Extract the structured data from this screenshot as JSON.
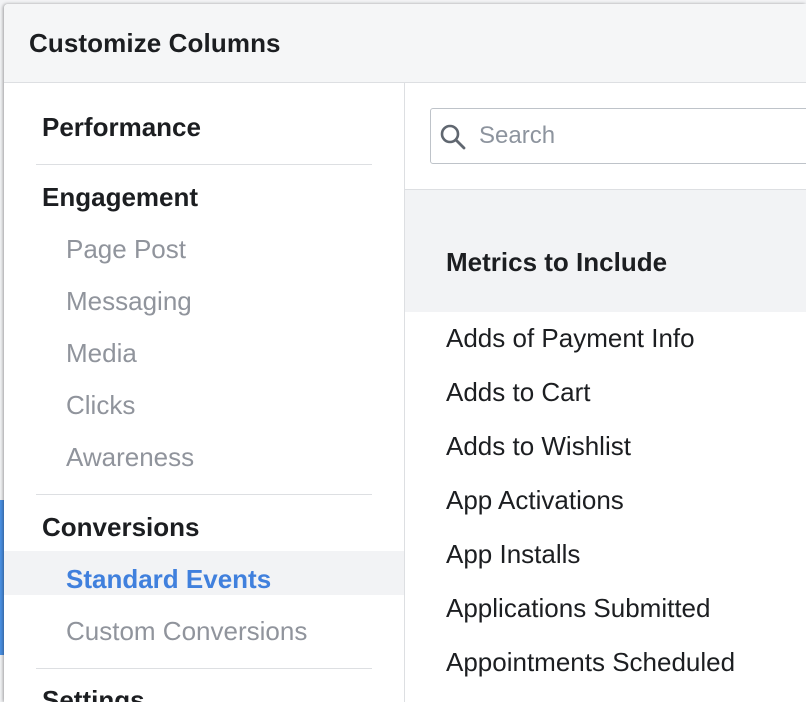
{
  "dialog": {
    "title": "Customize Columns"
  },
  "left_nav": {
    "performance": "Performance",
    "engagement": {
      "label": "Engagement",
      "items": [
        "Page Post",
        "Messaging",
        "Media",
        "Clicks",
        "Awareness"
      ]
    },
    "conversions": {
      "label": "Conversions",
      "items": [
        "Standard Events",
        "Custom Conversions"
      ],
      "active": "Standard Events"
    },
    "settings": "Settings"
  },
  "search": {
    "placeholder": "Search",
    "value": ""
  },
  "metrics": {
    "section_title": "Metrics to Include",
    "items": [
      "Adds of Payment Info",
      "Adds to Cart",
      "Adds to Wishlist",
      "App Activations",
      "App Installs",
      "Applications Submitted",
      "Appointments Scheduled"
    ]
  },
  "colors": {
    "accent": "#4080dd",
    "text": "#1c1e21",
    "muted": "#90949c"
  }
}
